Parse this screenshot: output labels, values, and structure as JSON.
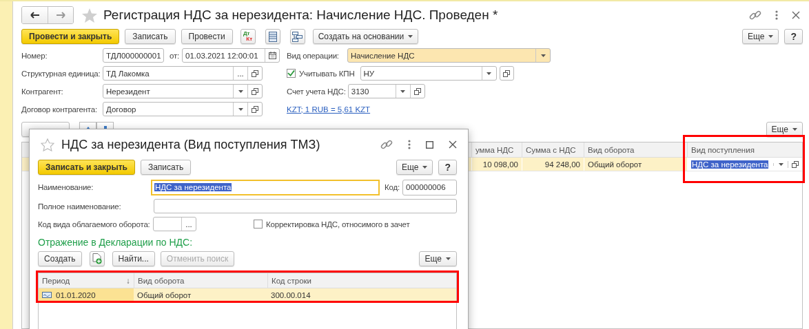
{
  "window": {
    "title": "Регистрация НДС за нерезидента: Начисление НДС. Проведен *"
  },
  "toolbar": [
    {
      "kind": "primary",
      "label": "Провести и закрыть"
    },
    {
      "kind": "default",
      "label": "Записать"
    },
    {
      "kind": "default",
      "label": "Провести"
    },
    {
      "kind": "dtkt",
      "top": "Дт",
      "bottom": "Кт"
    },
    {
      "kind": "list"
    },
    {
      "kind": "structure"
    },
    {
      "kind": "menu",
      "label": "Создать на основании"
    }
  ],
  "more_button": "Еще",
  "help_button": "?",
  "form": {
    "number": {
      "label": "Номер:",
      "value": "ТДЛ000000001"
    },
    "date": {
      "label": "от:",
      "value": "01.03.2021 12:00:01"
    },
    "operation": {
      "label": "Вид операции:",
      "value": "Начисление НДС",
      "highlighted": true
    },
    "unit": {
      "label": "Структурная единица:",
      "value": "ТД Лакомка",
      "choice_button": "..."
    },
    "kpn": {
      "label": "Учитывать КПН",
      "checked": true,
      "value": "НУ"
    },
    "counterparty": {
      "label": "Контрагент:",
      "value": "Нерезидент"
    },
    "vat_account": {
      "label": "Счет учета НДС:",
      "value": "3130"
    },
    "contract": {
      "label": "Договор контрагента:",
      "value": "Договор"
    },
    "rate_link": "KZT; 1 RUB = 5,61 KZT"
  },
  "table": {
    "more_button": "Еще",
    "columns": [
      {
        "label": "умма НДС",
        "kind": "number"
      },
      {
        "label": "Сумма с НДС",
        "kind": "number"
      },
      {
        "label": "Вид оборота",
        "kind": "text"
      },
      {
        "label": "Вид поступления",
        "kind": "ref"
      }
    ],
    "rows": [
      {
        "selected": true,
        "editing": true,
        "cells": [
          "10 098,00",
          "94 248,00",
          "Общий оборот",
          "НДС за нерезидента"
        ]
      }
    ]
  },
  "dialog": {
    "title": "НДС за нерезидента (Вид поступления ТМЗ)",
    "toolbar": [
      {
        "kind": "primary",
        "label": "Записать и закрыть"
      },
      {
        "kind": "default",
        "label": "Записать"
      }
    ],
    "more_button": "Еще",
    "help_button": "?",
    "name": {
      "label": "Наименование:",
      "value": "НДС за нерезидента",
      "focused": true
    },
    "code": {
      "label": "Код:",
      "value": "000000006"
    },
    "full_name": {
      "label": "Полное наименование:"
    },
    "turnover_code": {
      "label": "Код вида облагаемого оборота:",
      "choice_button": "..."
    },
    "vat_correction": {
      "label": "Корректировка НДС, относимого в зачет",
      "checked": false
    },
    "section_title": "Отражение в Декларации по НДС:",
    "list_toolbar": [
      {
        "kind": "default",
        "label": "Создать",
        "disabled": false
      },
      {
        "kind": "add",
        "disabled": false
      },
      {
        "kind": "default",
        "label": "Найти...",
        "disabled": false
      },
      {
        "kind": "default",
        "label": "Отменить поиск",
        "disabled": true
      }
    ],
    "list_more_button": "Еще",
    "list": {
      "columns": [
        {
          "label": "Период",
          "sort": "↓"
        },
        {
          "label": "Вид оборота"
        },
        {
          "label": "Код строки"
        }
      ],
      "rows": [
        {
          "selected": true,
          "cells": [
            "01.01.2020",
            "Общий оборот",
            "300.00.014"
          ]
        }
      ]
    }
  }
}
